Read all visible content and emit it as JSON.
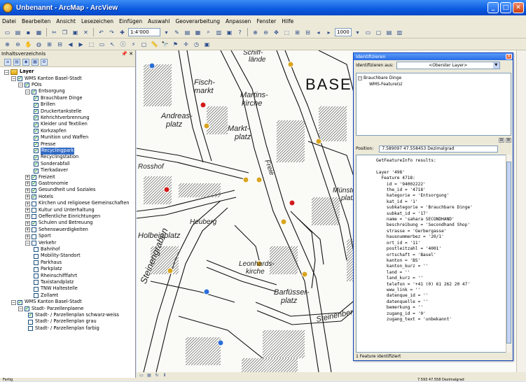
{
  "window": {
    "title": "Unbenannt - ArcMap - ArcView",
    "btn_min": "_",
    "btn_max": "□",
    "btn_close": "✕"
  },
  "menu": [
    "Datei",
    "Bearbeiten",
    "Ansicht",
    "Lesezeichen",
    "Einfügen",
    "Auswahl",
    "Geoverarbeitung",
    "Anpassen",
    "Fenster",
    "Hilfe"
  ],
  "toolbar": {
    "scale": "1:4'000",
    "scale_box": "1000"
  },
  "toc": {
    "title": "Inhaltsverzeichnis",
    "pin": "📌 ✕",
    "layers_label": "Layer",
    "wms1": "WMS Kanton Basel-Stadt",
    "pois": "POIs",
    "entsorgung": "Entsorgung",
    "entsorgung_items": [
      "Brauchbare Dinge",
      "Brillen",
      "Druckertankstelle",
      "Kehrichtverbrennung",
      "Kleider und Textilien",
      "Korkzapfen",
      "Munition und Waffen",
      "Presse",
      "Recyclingpark",
      "Recyclingstation",
      "Sonderabfall",
      "Tierkadaver"
    ],
    "poi_groups": [
      "Freizeit",
      "Gastronomie",
      "Gesundheit und Soziales",
      "Hotels",
      "Kirchen und religioese Gemeinschaften",
      "Kultur und Unterhaltung",
      "Oeffentliche Einrichtungen",
      "Schulen und Betreuung",
      "Sehenswuerdigkeiten",
      "Sport",
      "Verkehr"
    ],
    "verkehr_items": [
      "Bahnhof",
      "Mobility-Standort",
      "Parkhaus",
      "Parkplatz",
      "Rheinschifffahrt",
      "Taxistandplatz",
      "TNW Haltestelle",
      "Zollamt"
    ],
    "wms2": "WMS Kanton Basel-Stadt",
    "parzellen": "Stadt- Parzellenplaene",
    "parzellen_items": [
      "Stadt- / Parzellenplan schwarz-weiss",
      "Stadt- / Parzellenplan grau",
      "Stadt- / Parzellenplan farbig"
    ]
  },
  "identify": {
    "title": "Identifizieren",
    "from_label": "Identifizieren aus:",
    "from_value": "<Oberster Layer>",
    "tree_root": "Brauchbare Dinge",
    "tree_child": "WMS-Feature(s)",
    "position_label": "Position:",
    "position_value": "7.589097  47.558453 Dezimalgrad",
    "result_text": "GetFeatureInfo results:\n\nLayer '498'\n  Feature 4718:\n    id = '94002222'\n    the_id = '4718'\n    kategorie = 'Entsorgung'\n    kat_id = '1'\n    subkategorie = 'Brauchbare Dinge'\n    subkat_id = '17'\n    name = 'sahara SECONDHAND'\n    beschreibung = 'Secondhand Shop'\n    strasse = 'Gerbergasse'\n    hausnummerbez = '20/1'\n    ort_id = '11'\n    postleitzahl = '4001'\n    ortschaft = 'Basel'\n    kanton = 'BS'\n    kanton_kurz = ''\n    land = ''\n    land_kurz = ''\n    telefon = '+41 (0) 61 262 20 47'\n    www_link = ''\n    datenque_id = ''\n    datenquelle = ''\n    bemerkung = ''\n    zugang_id = '0'\n    zugang_text = 'unbekannt'",
    "footer": "1 Feature identifiziert"
  },
  "map_labels": {
    "base": "BASE",
    "l1": "Schiff-",
    "l2": "lände",
    "l3": "Fisch-",
    "l4": "markt",
    "l5": "Martins-",
    "l6": "kirche",
    "l7": "Andreas-",
    "l8": "platz",
    "l9": "Markt-",
    "l10": "platz",
    "l11": "Rosshof",
    "l12": "Heuberg",
    "l13": "Holbeinplatz",
    "l14": "Steinengraben",
    "l15": "Leonhards-",
    "l16": "kirche",
    "l17": "Barfüsser-",
    "l18": "platz",
    "l19": "Steinenberg",
    "l20": "Freie",
    "l21": "Münster-",
    "l22": "platz"
  },
  "status": {
    "left": "Fertig",
    "right": "7.593 47.558 Dezimalgrad"
  }
}
